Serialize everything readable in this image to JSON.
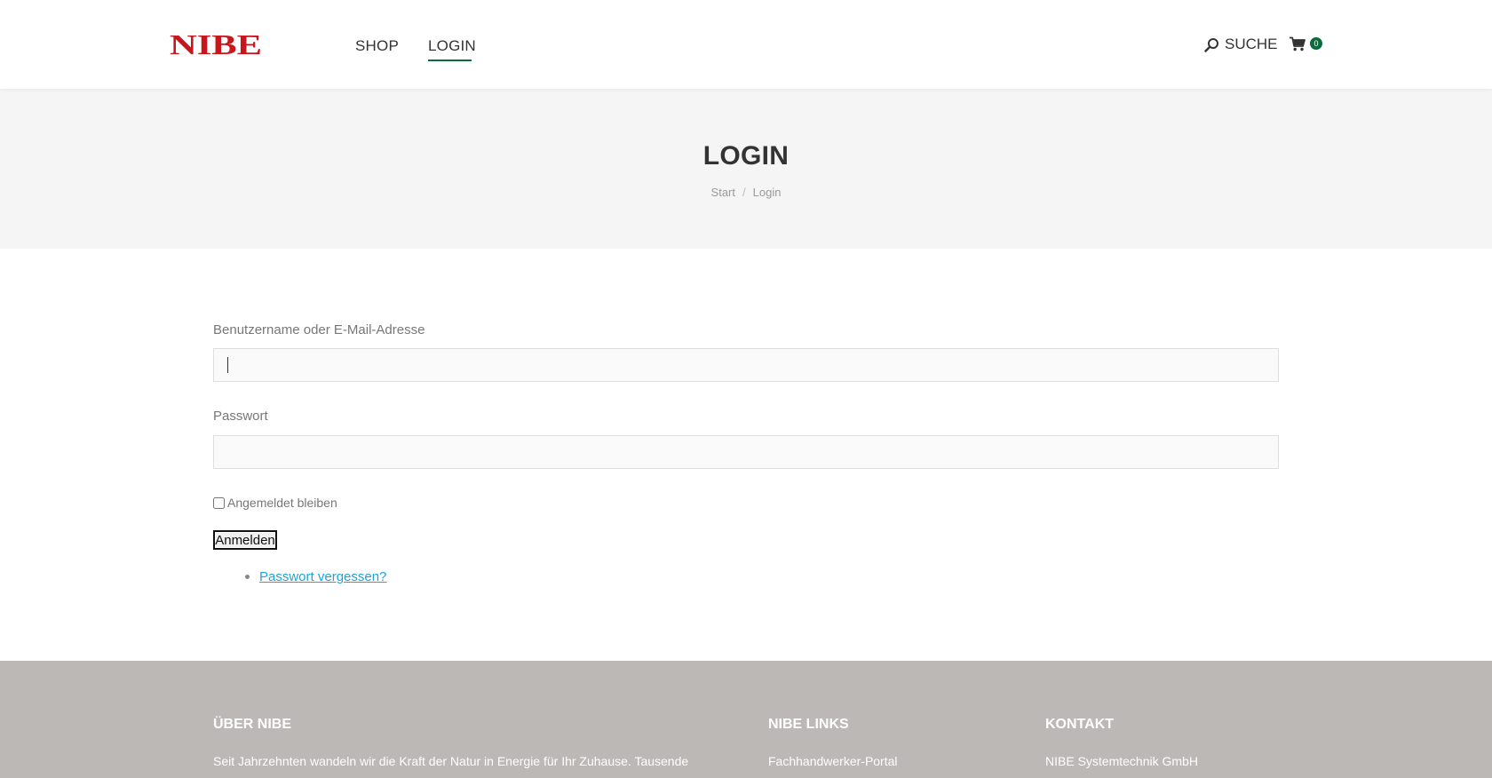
{
  "header": {
    "logo_text": "NIBE",
    "nav": [
      {
        "label": "SHOP"
      },
      {
        "label": "LOGIN"
      }
    ],
    "search_label": "SUCHE",
    "cart_count": "0"
  },
  "page": {
    "title": "LOGIN",
    "breadcrumb": [
      "Start",
      "Login"
    ],
    "breadcrumb_separator": "/"
  },
  "form": {
    "username_label": "Benutzername oder E-Mail-Adresse",
    "username_value": "",
    "password_label": "Passwort",
    "password_value": "",
    "remember_label": "Angemeldet bleiben",
    "remember_checked": false,
    "submit_label": "Anmelden",
    "forgot_label": "Passwort vergessen?"
  },
  "footer": {
    "col1": {
      "heading": "ÜBER NIBE",
      "text": "Seit Jahrzehnten wandeln wir die Kraft der Natur in Energie für Ihr Zuhause. Tausende"
    },
    "col2": {
      "heading": "NIBE LINKS",
      "text": "Fachhandwerker-Portal"
    },
    "col3": {
      "heading": "KONTAKT",
      "text": "NIBE Systemtechnik GmbH"
    }
  },
  "colors": {
    "brand_red": "#c8161d",
    "accent_green": "#0a6b3c",
    "link_blue": "#1ba6d6",
    "title_band": "#f5f5f5",
    "footer_bg": "#bcb8b5"
  }
}
